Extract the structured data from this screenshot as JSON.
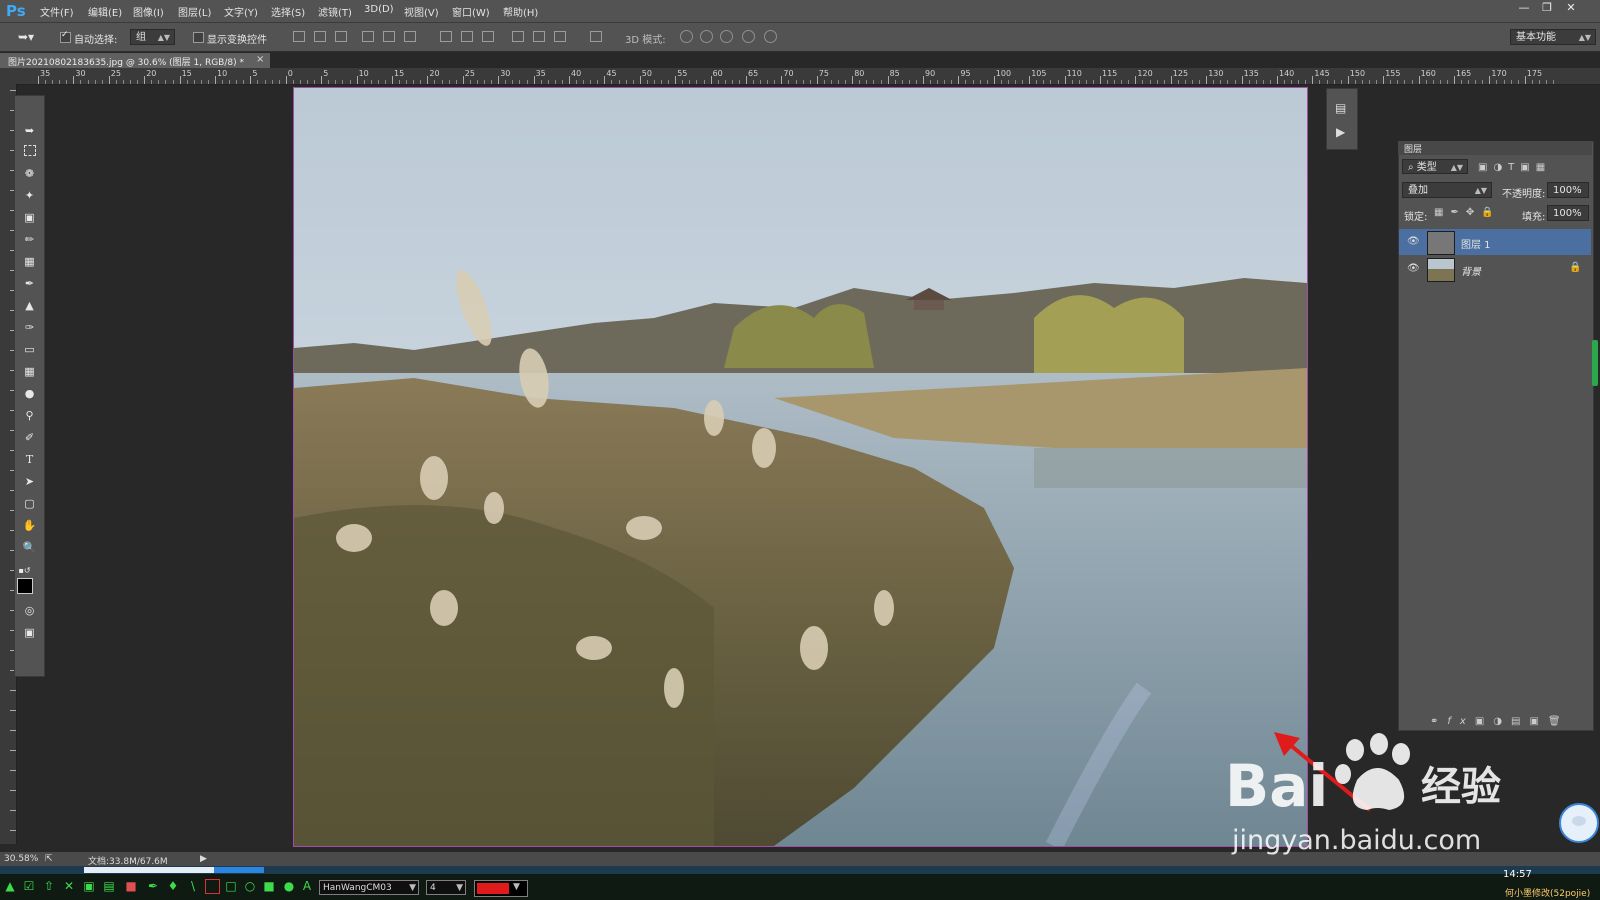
{
  "app": {
    "logo": "Ps",
    "menu": [
      "文件(F)",
      "编辑(E)",
      "图像(I)",
      "图层(L)",
      "文字(Y)",
      "选择(S)",
      "滤镜(T)",
      "3D(D)",
      "视图(V)",
      "窗口(W)",
      "帮助(H)"
    ],
    "window_controls": [
      "minimize",
      "restore",
      "close"
    ]
  },
  "options_bar": {
    "auto_select_label": "自动选择:",
    "auto_select_checked": true,
    "auto_select_value": "组",
    "show_transform_label": "显示变换控件",
    "show_transform_checked": false,
    "mode_3d_label": "3D 模式:",
    "workspace": "基本功能"
  },
  "document_tab": {
    "title": "图片20210802183635.jpg @ 30.6% (图层 1, RGB/8) *"
  },
  "rulers": {
    "horizontal_ticks": [
      "35",
      "30",
      "25",
      "20",
      "15",
      "10",
      "5",
      "0",
      "5",
      "10",
      "15",
      "20",
      "25",
      "30",
      "35",
      "40",
      "45",
      "50",
      "55",
      "60",
      "65",
      "70",
      "75",
      "80",
      "85",
      "90",
      "95",
      "100",
      "105",
      "110",
      "115",
      "120",
      "125",
      "130",
      "135",
      "140",
      "145",
      "150",
      "155",
      "160",
      "165",
      "170",
      "175"
    ]
  },
  "layers_panel": {
    "tab": "图层",
    "filter": "类型",
    "blend_mode": "叠加",
    "opacity_label": "不透明度:",
    "opacity_value": "100%",
    "lock_label": "锁定:",
    "fill_label": "填充:",
    "fill_value": "100%",
    "layers": [
      {
        "name": "图层 1",
        "selected": true,
        "locked": false,
        "visible": true
      },
      {
        "name": "背景",
        "selected": false,
        "locked": true,
        "visible": true
      }
    ]
  },
  "status_bar": {
    "zoom": "30.58%",
    "doc_size": "文档:33.8M/67.6M"
  },
  "taskbar": {
    "font_field": "HanWangCM03",
    "size_field": "4",
    "clock": "14:57",
    "user_label": "何小墨修改(52pojie)"
  },
  "watermark": {
    "brand_text": "Bai  经验",
    "url": "jingyan.baidu.com"
  },
  "colors": {
    "ps_blue": "#3fa9f5",
    "canvas_border": "#a04fa6",
    "arrow_red": "#e01b1b",
    "selected_layer": "#4a6fa0"
  }
}
